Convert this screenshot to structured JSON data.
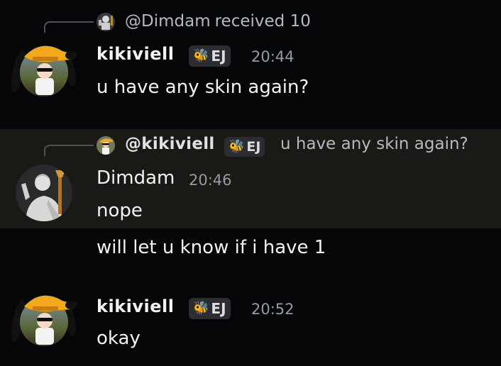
{
  "messages": [
    {
      "reply": {
        "mention": "@Dimdam",
        "text": "received 10"
      },
      "author": "kikiviell",
      "tag": "EJ",
      "time": "20:44",
      "lines": [
        "u have any skin again?"
      ]
    },
    {
      "reply": {
        "mention": "@kikiviell",
        "tag": "EJ",
        "text": "u have any skin again?"
      },
      "author": "Dimdam",
      "time": "20:46",
      "lines": [
        "nope",
        "will let u know if i have 1"
      ],
      "highlighted": true
    },
    {
      "author": "kikiviell",
      "tag": "EJ",
      "time": "20:52",
      "lines": [
        "okay"
      ]
    }
  ],
  "colors": {
    "background": "#050608",
    "highlight": "#1b1915",
    "tag_bg": "#2b2d31",
    "timestamp": "#949ba4",
    "text": "#f2f3f5"
  },
  "icons": {
    "tag_icon": "bee-icon",
    "avatar_kiki": "dog-hat-avatar",
    "avatar_dimdam": "statue-avatar"
  }
}
